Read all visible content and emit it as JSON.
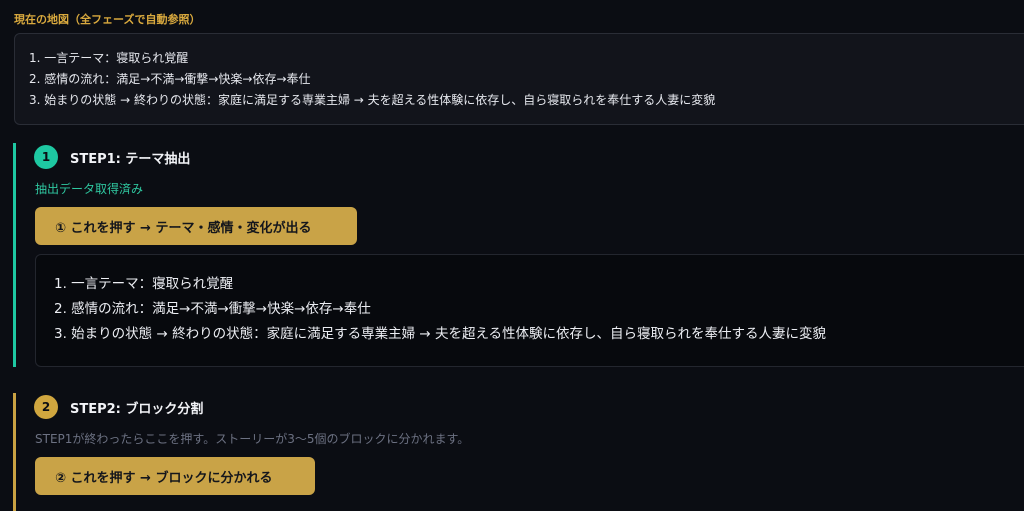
{
  "current_map": {
    "title": "現在の地図（全フェーズで自動参照）",
    "lines": [
      "1. 一言テーマ：寝取られ覚醒",
      "2. 感情の流れ：満足→不満→衝撃→快楽→依存→奉仕",
      "3. 始まりの状態 → 終わりの状態：家庭に満足する専業主婦 → 夫を超える性体験に依存し、自ら寝取られを奉仕する人妻に変貌"
    ]
  },
  "step1": {
    "number": "1",
    "title": "STEP1: テーマ抽出",
    "status": "抽出データ取得済み",
    "button_label": "① これを押す → テーマ・感情・変化が出る",
    "output_lines": [
      "1. 一言テーマ：寝取られ覚醒",
      "2. 感情の流れ：満足→不満→衝撃→快楽→依存→奉仕",
      "3. 始まりの状態 → 終わりの状態：家庭に満足する専業主婦 → 夫を超える性体験に依存し、自ら寝取られを奉仕する人妻に変貌"
    ]
  },
  "step2": {
    "number": "2",
    "title": "STEP2: ブロック分割",
    "hint": "STEP1が終わったらここを押す。ストーリーが3～5個のブロックに分かれます。",
    "button_label": "② これを押す → ブロックに分かれる"
  },
  "colors": {
    "accent_teal": "#1ec8a2",
    "accent_gold": "#c9a347",
    "background": "#0b0d13"
  }
}
